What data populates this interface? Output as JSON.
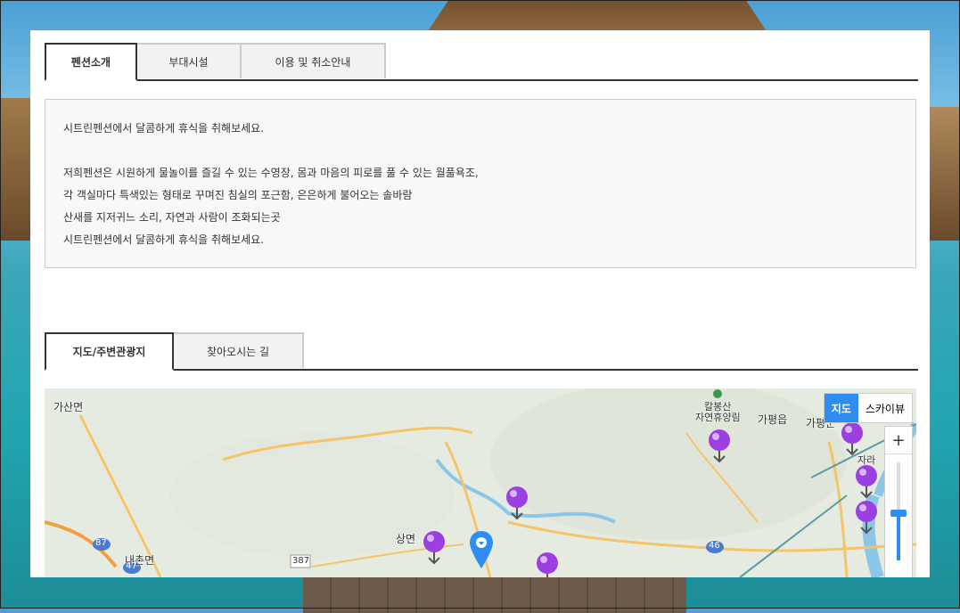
{
  "tabs1": [
    {
      "label": "펜션소개",
      "active": true
    },
    {
      "label": "부대시설",
      "active": false
    },
    {
      "label": "이용 및 취소안내",
      "active": false
    }
  ],
  "intro": {
    "line1": "시트린펜션에서 달콤하게 휴식을 취해보세요.",
    "line2": "저희펜션은 시원하게 물놀이를 즐길 수 있는 수영장, 몸과 마음의 피로를 풀 수 있는 월풀욕조,",
    "line3": "각 객실마다 특색있는 형태로 꾸며진 침실의 포근함, 은은하게 불어오는 솔바람",
    "line4": "산새를 지저귀느 소리, 자연과 사람이 조화되는곳",
    "line5": "시트린펜션에서 달콤하게 휴식을 취해보세요."
  },
  "tabs2": [
    {
      "label": "지도/주변관광지",
      "active": true
    },
    {
      "label": "찾아오시는 길",
      "active": false
    }
  ],
  "map": {
    "type_map": "지도",
    "type_sky": "스카이뷰",
    "zoom_in": "+",
    "labels": {
      "gasan": "가산면",
      "naechon": "내촌면",
      "sangmyeon": "상면",
      "kalbong": "칼봉산",
      "kalbong2": "자연휴양림",
      "gapyeong": "가평읍",
      "gapyeong2": "가평군",
      "jara": "자라",
      "r87": "87",
      "r47": "47",
      "r387": "387",
      "r46": "46"
    },
    "colors": {
      "accent": "#2f8cf0",
      "pin": "#9b3fe0",
      "water": "#8cc6e7",
      "road": "#f5c46a"
    }
  }
}
